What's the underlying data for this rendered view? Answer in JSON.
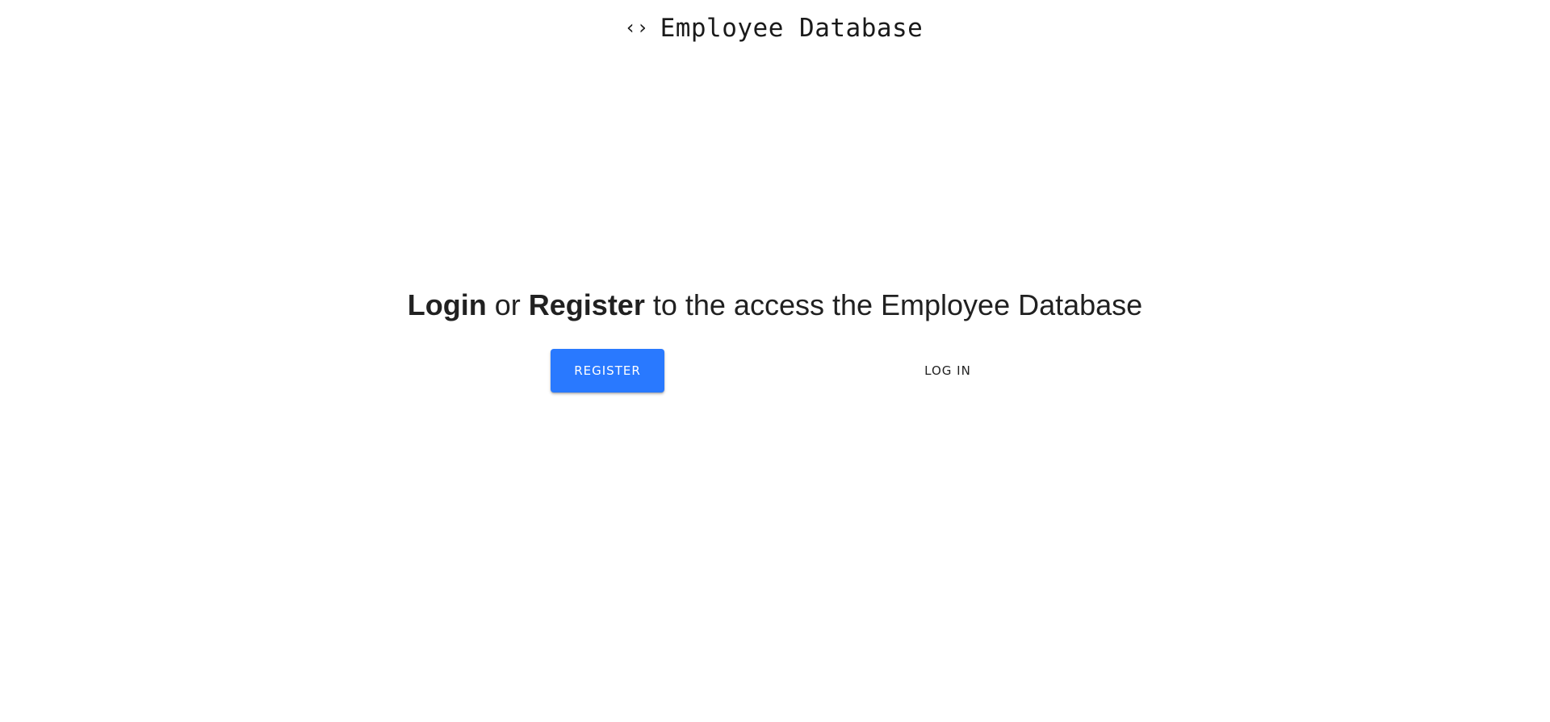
{
  "header": {
    "icon": "code-brackets-icon",
    "icon_glyph": "‹›",
    "title": "Employee Database"
  },
  "main": {
    "headline": {
      "login_word": "Login",
      "or_word": " or ",
      "register_word": "Register",
      "rest": " to the access the Employee Database"
    },
    "register_button_label": "Register",
    "login_button_label": "Log In"
  },
  "colors": {
    "accent": "#2979ff",
    "text": "#212121",
    "background": "#ffffff"
  }
}
